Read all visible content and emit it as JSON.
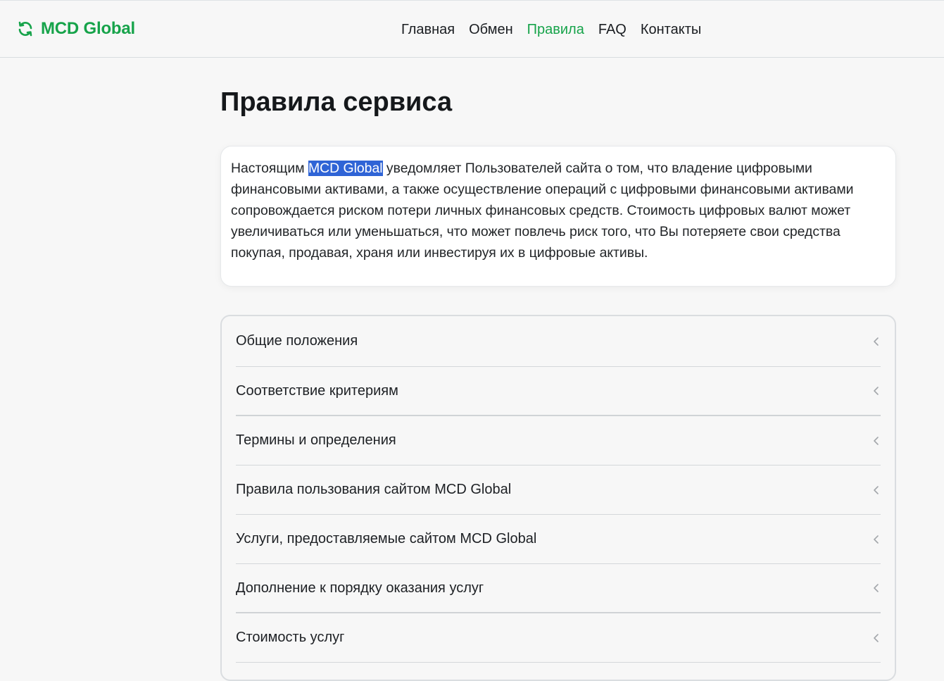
{
  "brand": {
    "name": "MCD Global",
    "color": "#16a34a",
    "icon": "refresh-icon"
  },
  "nav": {
    "items": [
      {
        "label": "Главная",
        "active": false
      },
      {
        "label": "Обмен",
        "active": false
      },
      {
        "label": "Правила",
        "active": true
      },
      {
        "label": "FAQ",
        "active": false
      },
      {
        "label": "Контакты",
        "active": false
      }
    ]
  },
  "page": {
    "title": "Правила сервиса",
    "notice": {
      "before": "Настоящим ",
      "highlighted": "MCD Global",
      "after": " уведомляет Пользователей сайта о том, что владение цифровыми финансовыми активами, а также осуществление операций с цифровыми финансовыми активами сопровождается риском потери личных финансовых средств. Стоимость цифровых валют может увеличиваться или уменьшаться, что может повлечь риск того, что Вы потеряете свои средства покупая, продавая, храня или инвестируя их в цифровые активы."
    }
  },
  "rules": {
    "sections": [
      {
        "label": "Общие положения",
        "icon": "chevron-left-icon"
      },
      {
        "label": "Соответствие критериям",
        "icon": "chevron-left-icon"
      },
      {
        "label": "Термины и определения",
        "icon": "chevron-left-icon"
      },
      {
        "label": "Правила пользования сайтом MCD Global",
        "icon": "chevron-left-icon"
      },
      {
        "label": "Услуги, предоставляемые сайтом MCD Global",
        "icon": "chevron-left-icon"
      },
      {
        "label": "Дополнение к порядку оказания услуг",
        "icon": "chevron-left-icon"
      },
      {
        "label": "Стоимость услуг",
        "icon": "chevron-left-icon"
      }
    ]
  }
}
